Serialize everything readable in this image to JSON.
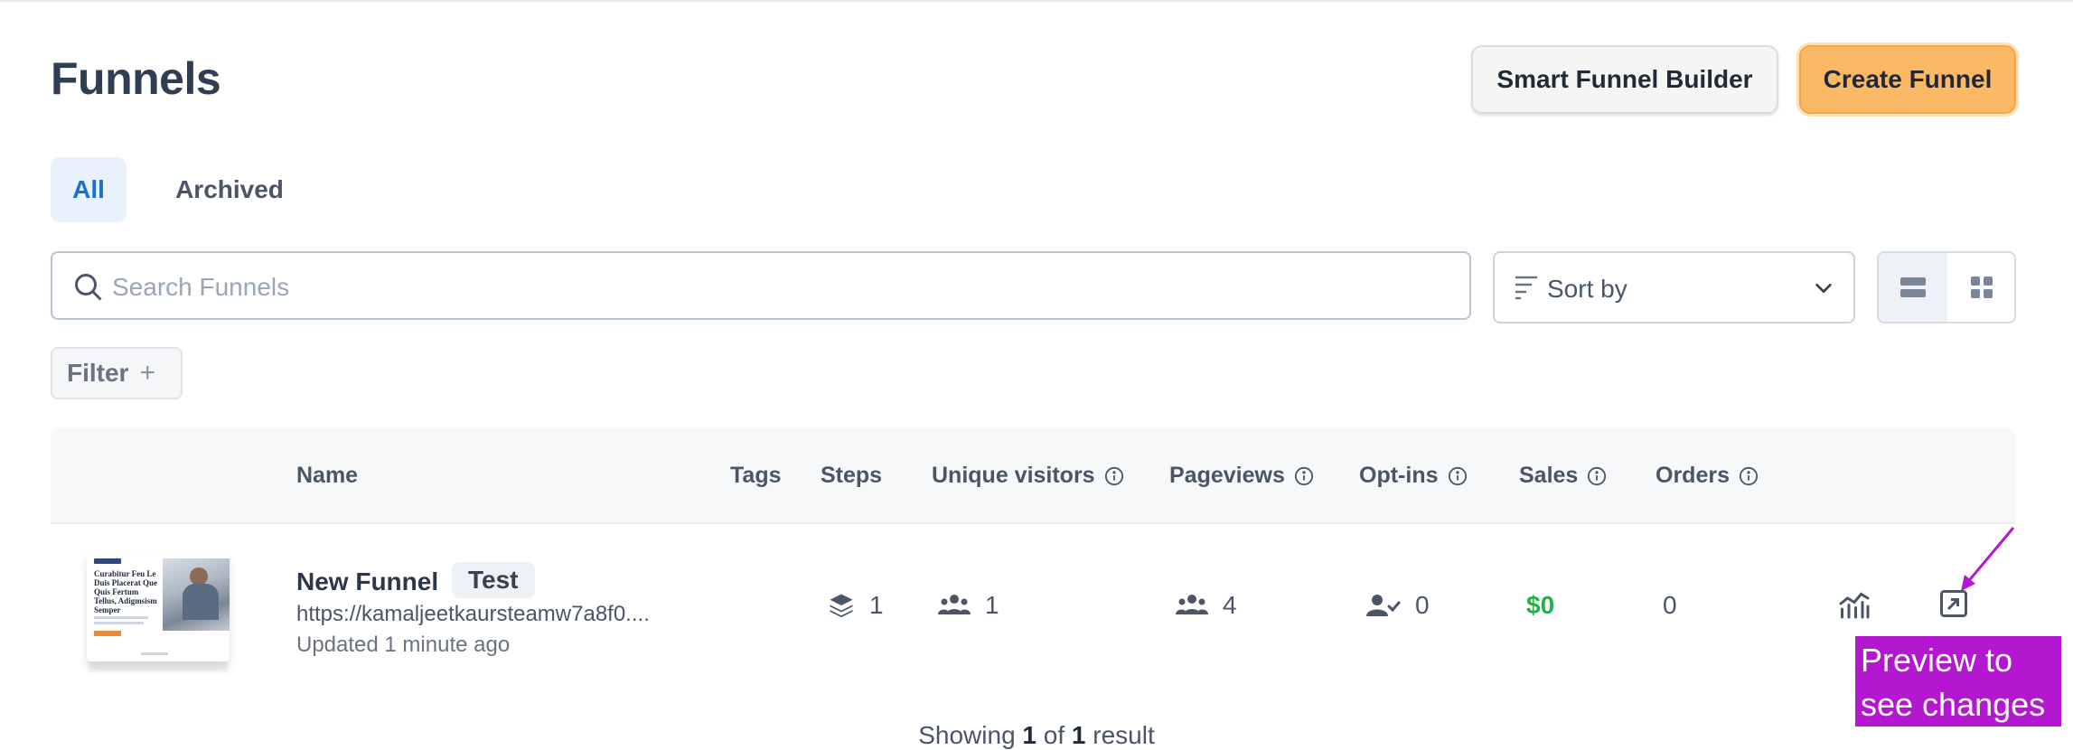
{
  "page": {
    "title": "Funnels"
  },
  "header": {
    "smart_builder_label": "Smart Funnel Builder",
    "create_label": "Create Funnel"
  },
  "tabs": [
    {
      "label": "All",
      "active": true
    },
    {
      "label": "Archived",
      "active": false
    }
  ],
  "search": {
    "placeholder": "Search Funnels"
  },
  "sort": {
    "label": "Sort by"
  },
  "view_toggle": {
    "selected": "list"
  },
  "filter": {
    "label": "Filter",
    "plus": "+"
  },
  "table": {
    "columns": [
      "Name",
      "Tags",
      "Steps",
      "Unique visitors",
      "Pageviews",
      "Opt-ins",
      "Sales",
      "Orders"
    ],
    "rows": [
      {
        "name": "New Funnel",
        "tag": "Test",
        "url": "https://kamaljeetkaursteamw7a8f0....",
        "updated": "Updated 1 minute ago",
        "steps": "1",
        "unique_visitors": "1",
        "pageviews": "4",
        "optins": "0",
        "sales": "$0",
        "orders": "0",
        "thumbnail_heading": "Curabitur Feu Le Duis Placerat Que Quis Fertum Tellus, Adigmsism Semper"
      }
    ]
  },
  "annotation": {
    "text": "Preview to see changes",
    "color": "#b318d0"
  },
  "pagination": {
    "prefix": "Showing",
    "from": "1",
    "of_word": "of",
    "total": "1",
    "suffix": "result"
  },
  "colors": {
    "accent_blue": "#1a6fd3",
    "primary_button": "#fbb966",
    "sales_green": "#22b04b"
  }
}
